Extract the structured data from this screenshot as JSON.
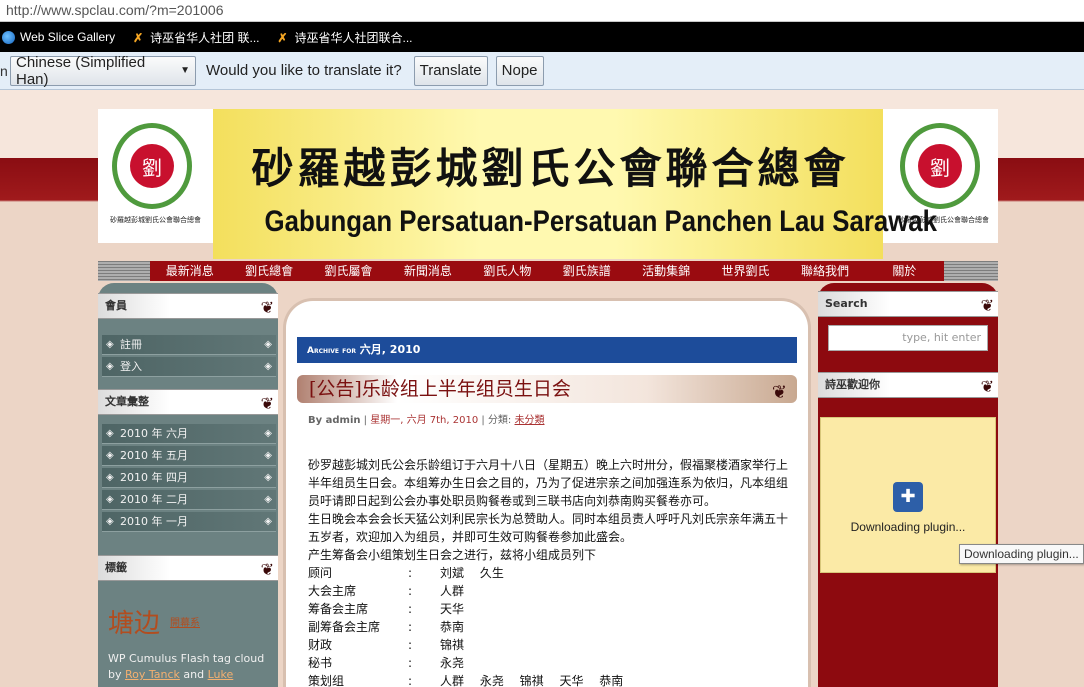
{
  "browser": {
    "url": "http://www.spclau.com/?m=201006",
    "favorites": [
      {
        "icon": "ie-icon",
        "label": "Web Slice Gallery"
      },
      {
        "icon": "joomla-icon",
        "label": "诗巫省华人社团 联..."
      },
      {
        "icon": "joomla-icon",
        "label": "诗巫省华人社团联合..."
      }
    ],
    "translate_bar": {
      "edge_text": "n",
      "language": "Chinese (Simplified Han)",
      "message": "Would you like to translate it?",
      "translate_label": "Translate",
      "nope_label": "Nope"
    }
  },
  "header": {
    "cn_title": "砂羅越彭城劉氏公會聯合總會",
    "en_title": "Gabungan Persatuan-Persatuan Panchen Lau Sarawak",
    "emblem_caption": "砂羅越彭城劉氏公會聯合總會",
    "emblem_seal": "劉"
  },
  "nav": [
    "最新消息",
    "劉氏總會",
    "劉氏屬會",
    "新聞消息",
    "劉氏人物",
    "劉氏族譜",
    "活動集錦",
    "世界劉氏",
    "聯絡我們",
    "關於"
  ],
  "left_sidebar": {
    "members_title": "會員",
    "members_items": [
      "註冊",
      "登入"
    ],
    "archive_title": "文章彙整",
    "archive_items": [
      "2010 年 六月",
      "2010 年 五月",
      "2010 年 四月",
      "2010 年 二月",
      "2010 年 一月"
    ],
    "tags_title": "標籤",
    "tag_big": "塘边",
    "tag_small": "開幕系",
    "cumulus_prefix": "WP Cumulus Flash tag cloud by",
    "cumulus_link1": "Roy Tanck",
    "cumulus_and": "and",
    "cumulus_link2": "Luke"
  },
  "content": {
    "archive_label": "Archive for",
    "archive_month": "六月, 2010",
    "post_title": "[公告]乐龄组上半年组员生日会",
    "meta_by": "By admin",
    "meta_date": "星期一, 六月 7th, 2010",
    "meta_cat_label": "分類:",
    "meta_cat": "未分類",
    "paragraphs": [
      "砂罗越彭城刘氏公会乐龄组订于六月十八日（星期五）晚上六时卅分，假福聚楼酒家举行上半年组员生日会。本组筹办生日会之目的，乃为了促进宗亲之间加强连系为依归，凡本组组员吁请即日起到公会办事处职员购餐卷或到三联书店向刘恭南购买餐卷亦可。",
      "生日晚会本会会长天猛公刘利民宗长为总赞助人。同时本组员责人呼吁凡刘氏宗亲年满五十五岁者，欢迎加入为组员，并即可生效可购餐卷参加此盛会。",
      "产生筹备会小组策划生日会之进行，兹将小组成员列下"
    ],
    "committee": [
      {
        "role": "顾问",
        "colon": ":",
        "names": "刘斌　 久生"
      },
      {
        "role": "大会主席",
        "colon": ":",
        "names": "人群"
      },
      {
        "role": "筹备会主席",
        "colon": ":",
        "names": "天华"
      },
      {
        "role": "副筹备会主席",
        "colon": ":",
        "names": "恭南"
      },
      {
        "role": "财政",
        "colon": ":",
        "names": "锦祺"
      },
      {
        "role": "秘书",
        "colon": ":",
        "names": "永尧"
      },
      {
        "role": "策划组",
        "colon": ":",
        "names": "人群　 永尧　 锦祺　 天华　 恭南"
      }
    ]
  },
  "right_sidebar": {
    "search_title": "Search",
    "search_placeholder": "type, hit enter",
    "widget_title": "詩巫歡迎你",
    "plugin_text": "Downloading plugin...",
    "tooltip": "Downloading plugin..."
  }
}
